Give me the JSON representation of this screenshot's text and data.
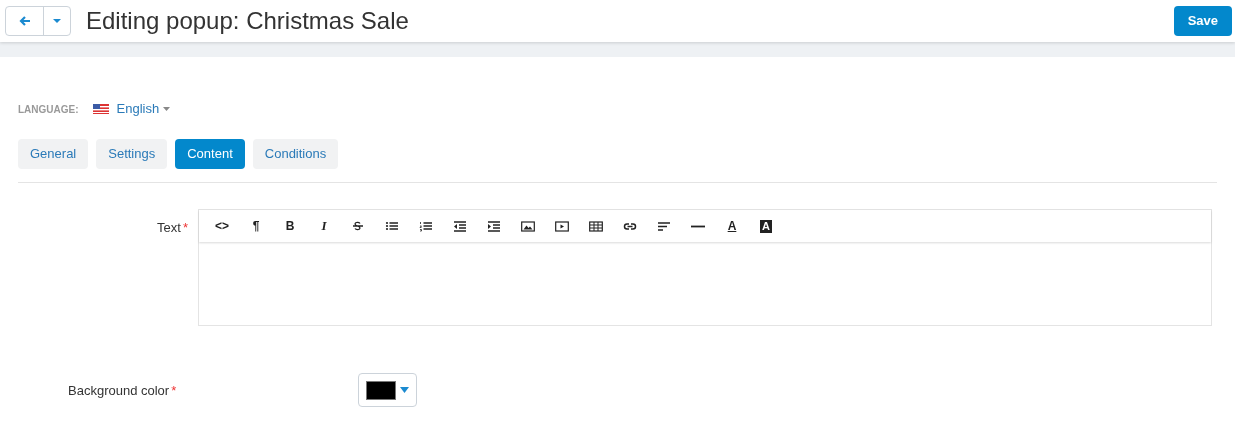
{
  "header": {
    "title": "Editing popup: Christmas Sale",
    "save_button": "Save"
  },
  "language": {
    "label": "LANGUAGE:",
    "value": "English"
  },
  "tabs": [
    {
      "label": "General",
      "selected": false
    },
    {
      "label": "Settings",
      "selected": false
    },
    {
      "label": "Content",
      "selected": true
    },
    {
      "label": "Conditions",
      "selected": false
    }
  ],
  "text_field": {
    "label": "Text",
    "required_mark": "*",
    "toolbar": [
      {
        "kind": "glyph",
        "glyph": "<>"
      },
      {
        "kind": "glyph",
        "glyph": "¶"
      },
      {
        "kind": "bold",
        "glyph": "B"
      },
      {
        "kind": "italic",
        "glyph": "I"
      },
      {
        "kind": "strike"
      },
      {
        "kind": "bullets"
      },
      {
        "kind": "numbers"
      },
      {
        "kind": "outdent"
      },
      {
        "kind": "indent"
      },
      {
        "kind": "image"
      },
      {
        "kind": "video"
      },
      {
        "kind": "table"
      },
      {
        "kind": "link"
      },
      {
        "kind": "align"
      },
      {
        "kind": "rule"
      },
      {
        "kind": "fontcolor",
        "glyph": "A"
      },
      {
        "kind": "bgcolor",
        "glyph": "A"
      }
    ]
  },
  "background_color": {
    "label": "Background color",
    "required_mark": "*",
    "color": "#000000"
  }
}
